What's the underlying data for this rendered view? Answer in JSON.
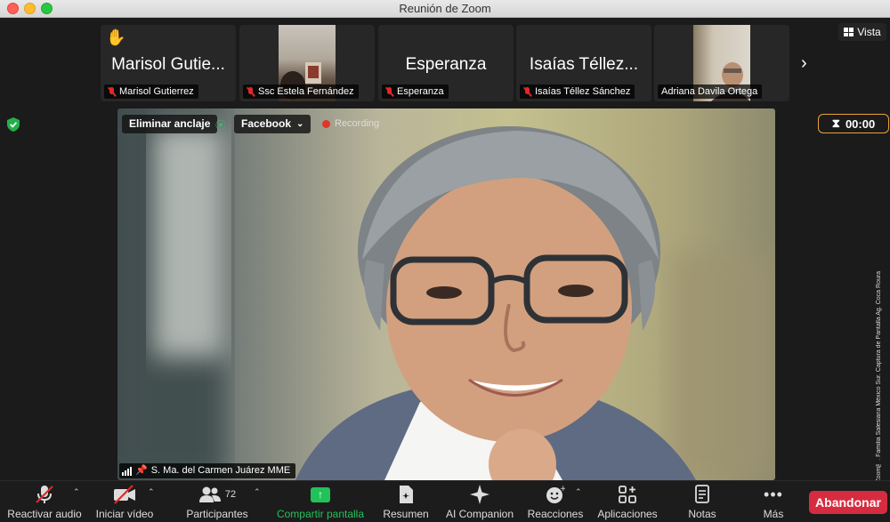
{
  "window": {
    "title": "Reunión de Zoom"
  },
  "view_button": {
    "label": "Vista"
  },
  "thumbnails": [
    {
      "big_name": "Marisol Gutie...",
      "label": "Marisol Gutierrez",
      "raised_hand": "✋",
      "muted": true,
      "has_video": false
    },
    {
      "big_name": "",
      "label": "Ssc Estela Fernández",
      "muted": true,
      "has_video": true
    },
    {
      "big_name": "Esperanza",
      "label": "Esperanza",
      "muted": true,
      "has_video": false
    },
    {
      "big_name": "Isaías Téllez...",
      "label": "Isaías Téllez Sánchez",
      "muted": true,
      "has_video": false
    },
    {
      "big_name": "",
      "label": "Adriana Davila Ortega",
      "muted": false,
      "has_video": true
    }
  ],
  "timer": {
    "value": "00:00",
    "icon": "hourglass-icon",
    "border_color": "#e8a33a"
  },
  "main_video": {
    "unpin_label": "Eliminar anclaje",
    "stream_target": "Facebook",
    "recording_label": "Recording",
    "speaker_name": "S. Ma. del Carmen Juárez MME"
  },
  "watermark": "Cortesía © Zoom™. Familia Salesiana México Sur. Captura de Pantalla Ag. Coca Roura",
  "toolbar": {
    "unmute": "Reactivar audio",
    "start_video": "Iniciar vídeo",
    "participants": "Participantes",
    "participant_count": "72",
    "share": "Compartir pantalla",
    "summary": "Resumen",
    "companion": "AI Companion",
    "reactions": "Reacciones",
    "apps": "Aplicaciones",
    "notes": "Notas",
    "more": "Más",
    "leave": "Abandonar"
  },
  "colors": {
    "accent_green": "#22c25a",
    "leave_red": "#d72c3f",
    "recording_red": "#e0352b",
    "mute_red": "#e02828"
  }
}
